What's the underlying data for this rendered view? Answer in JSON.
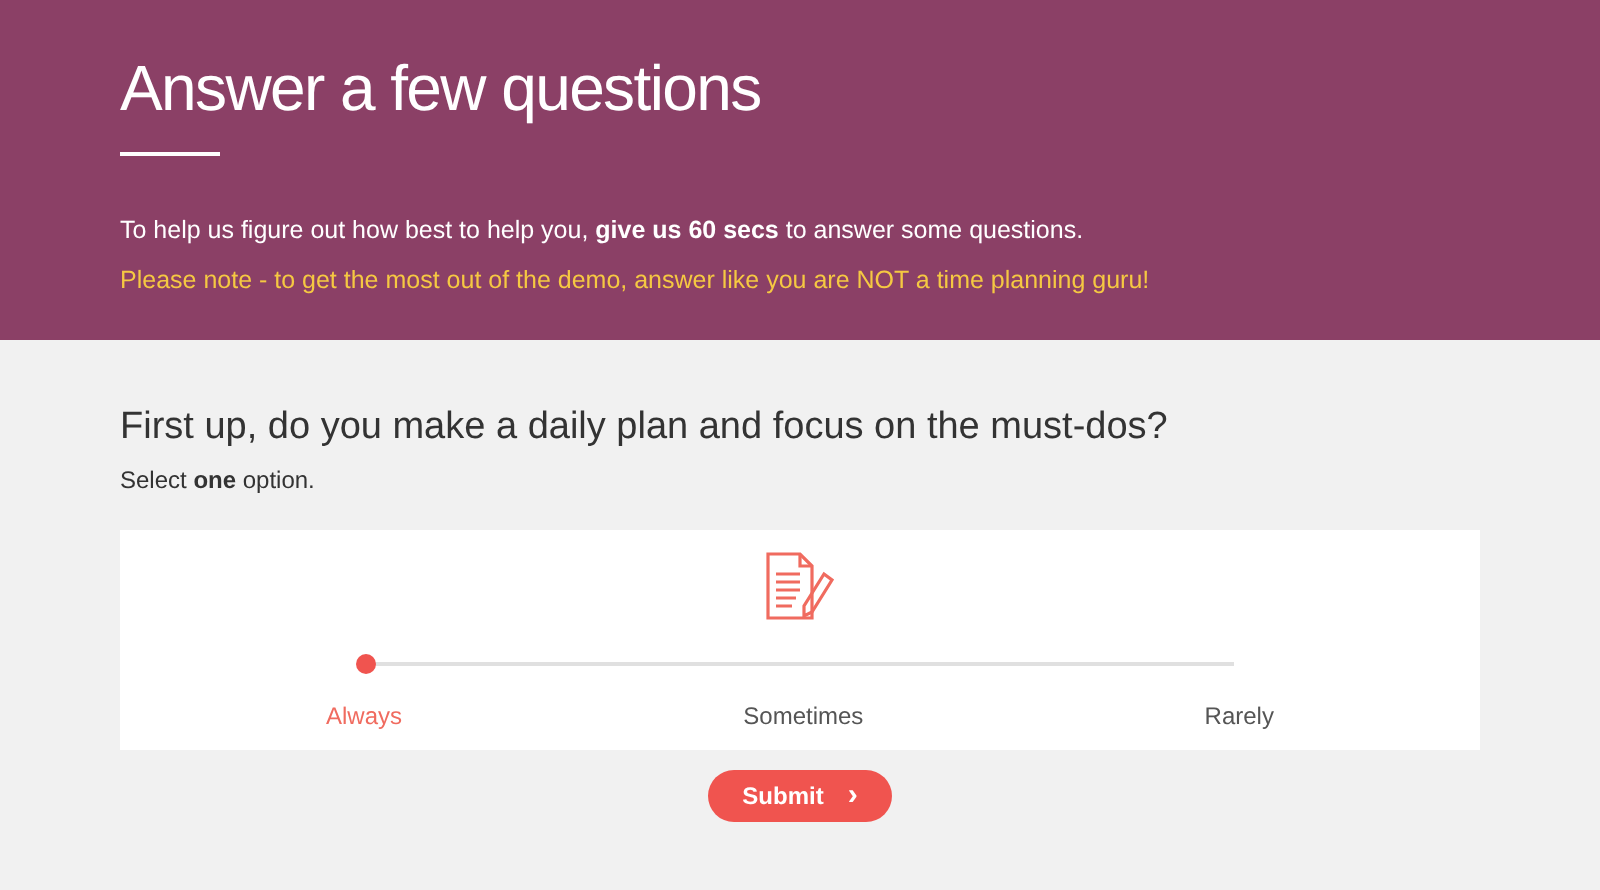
{
  "header": {
    "title": "Answer a few questions",
    "intro": "To help us figure out how best to help you, **give us 60 secs** to answer some questions.",
    "note": "Please note - to get the most out of the demo, answer like you are NOT a time planning guru!"
  },
  "question": {
    "text": "First up, do you make a daily plan and focus on the must-dos?",
    "hint": "Select **one** option."
  },
  "slider": {
    "level": 0,
    "options": [
      {
        "label": "Always",
        "selected": true
      },
      {
        "label": "Sometimes",
        "selected": false
      },
      {
        "label": "Rarely",
        "selected": false
      }
    ]
  },
  "submit": {
    "label": "Submit",
    "icon": "›"
  }
}
